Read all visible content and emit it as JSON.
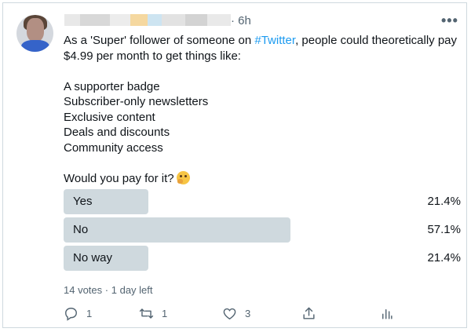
{
  "tweet": {
    "time": "6h",
    "more_label": "•••",
    "text_lines": [
      "As a 'Super' follower of someone on ",
      "$4.99 per month to get things like:",
      "A supporter badge",
      "Subscriber-only newsletters",
      "Exclusive content",
      "Deals and discounts",
      "Community access",
      "Would you pay for it?"
    ],
    "hashtag": "#Twitter",
    "line1_suffix": ", people could theoretically pay",
    "emoji_icon": "thinking-face-icon"
  },
  "poll": {
    "options": [
      {
        "label": "Yes",
        "percent_text": "21.4%",
        "fraction": 0.214
      },
      {
        "label": "No",
        "percent_text": "57.1%",
        "fraction": 0.571
      },
      {
        "label": "No way",
        "percent_text": "21.4%",
        "fraction": 0.214
      }
    ],
    "votes": "14 votes",
    "separator": "·",
    "time_left": "1 day left",
    "bar_color": "#cfd9de"
  },
  "actions": {
    "reply_count": "1",
    "retweet_count": "1",
    "like_count": "3",
    "icons": [
      "reply-icon",
      "retweet-icon",
      "like-icon",
      "share-icon",
      "analytics-icon"
    ]
  }
}
